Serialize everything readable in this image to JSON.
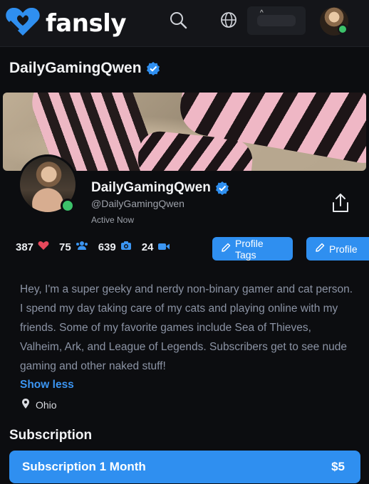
{
  "header": {
    "brand": "fansly",
    "icons": [
      "heart-logo-icon",
      "search-icon",
      "globe-icon"
    ],
    "account_caret": "^"
  },
  "page_title": "DailyGamingQwen",
  "profile": {
    "name": "DailyGamingQwen",
    "handle": "@DailyGamingQwen",
    "status": "Active Now"
  },
  "stats": {
    "likes": "387",
    "followers": "75",
    "images": "639",
    "videos": "24"
  },
  "buttons": {
    "profile_tags": "Profile Tags",
    "profile": "Profile"
  },
  "bio": {
    "text": "Hey, I'm a super geeky and nerdy non-binary gamer and cat person. I spend my day taking care of my cats and playing online with my friends. Some of my favorite games include Sea of Thieves, Valheim, Ark, and League of Legends. Subscribers get to see nude gaming and other naked stuff!",
    "toggle": "Show less",
    "location": "Ohio"
  },
  "subscription": {
    "title": "Subscription",
    "plan": "Subscription 1 Month",
    "price": "$5"
  },
  "colors": {
    "accent": "#2f8ff0",
    "background": "#0c0d10",
    "online": "#3cc26a",
    "heart": "#e5485b"
  }
}
